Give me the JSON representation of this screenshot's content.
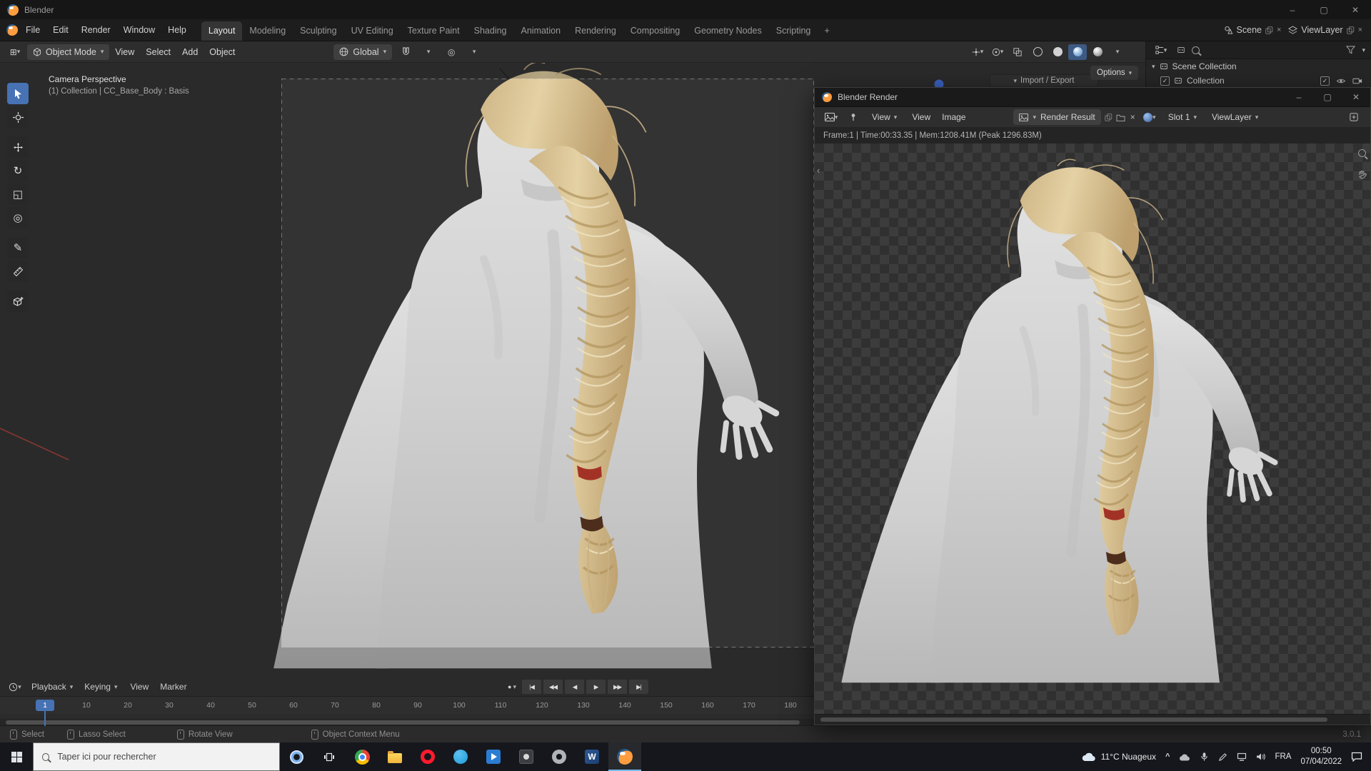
{
  "titlebar": {
    "title": "Blender",
    "minimize": "–",
    "maximize": "▢",
    "close": "✕"
  },
  "menubar": [
    "File",
    "Edit",
    "Render",
    "Window",
    "Help"
  ],
  "workspaces": [
    {
      "label": "Layout",
      "active": true
    },
    {
      "label": "Modeling"
    },
    {
      "label": "Sculpting"
    },
    {
      "label": "UV Editing"
    },
    {
      "label": "Texture Paint"
    },
    {
      "label": "Shading"
    },
    {
      "label": "Animation"
    },
    {
      "label": "Rendering"
    },
    {
      "label": "Compositing"
    },
    {
      "label": "Geometry Nodes"
    },
    {
      "label": "Scripting"
    }
  ],
  "workspace_add": "+",
  "scene": {
    "label": "Scene"
  },
  "view_layer": {
    "label": "ViewLayer"
  },
  "viewport_header": {
    "mode": "Object Mode",
    "menus": [
      "View",
      "Select",
      "Add",
      "Object"
    ],
    "orientation": "Global",
    "options": "Options"
  },
  "viewport": {
    "overlay_title": "Camera Perspective",
    "overlay_subtitle": "(1) Collection | CC_Base_Body : Basis",
    "npanel_tab": "Import / Export",
    "tools": [
      "tweak-select",
      "cursor",
      "move",
      "rotate",
      "scale",
      "transform",
      "annotate",
      "measure",
      "add-cube"
    ]
  },
  "outliner": {
    "rows": [
      {
        "label": "Scene Collection"
      },
      {
        "label": "Collection"
      }
    ]
  },
  "timeline": {
    "dropdowns": [
      "Playback",
      "Keying"
    ],
    "menus": [
      "View",
      "Marker"
    ],
    "frames": [
      "1",
      "10",
      "20",
      "30",
      "40",
      "50",
      "60",
      "70",
      "80",
      "90",
      "100",
      "110",
      "120",
      "130",
      "140",
      "150",
      "160",
      "170",
      "180"
    ],
    "current_frame": "1"
  },
  "status_bar": {
    "hints": [
      {
        "label": "Select"
      },
      {
        "label": "Lasso Select"
      },
      {
        "label": "Rotate View"
      },
      {
        "label": "Object Context Menu"
      }
    ],
    "version": "3.0.1"
  },
  "render_window": {
    "title": "Blender Render",
    "minimize": "–",
    "maximize": "▢",
    "close": "✕",
    "view_dropdown": "View",
    "menus": [
      "View",
      "Image"
    ],
    "image_name": "Render Result",
    "slot": "Slot 1",
    "layer": "ViewLayer",
    "stats": "Frame:1 | Time:00:33.35 | Mem:1208.41M (Peak 1296.83M)"
  },
  "taskbar": {
    "search_placeholder": "Taper ici pour rechercher",
    "weather": "11°C  Nuageux",
    "language": "FRA",
    "time": "00:50",
    "date": "07/04/2022",
    "apps": [
      "start",
      "search",
      "cortana",
      "task-view",
      "chrome",
      "file-explorer",
      "opera",
      "blue-app",
      "media-app",
      "dark-app",
      "settings-app",
      "word",
      "blender"
    ]
  },
  "colors": {
    "accent_blue": "#4772b3",
    "blender_orange": "#ea7600",
    "viewport_bg": "#3a3a3a"
  }
}
